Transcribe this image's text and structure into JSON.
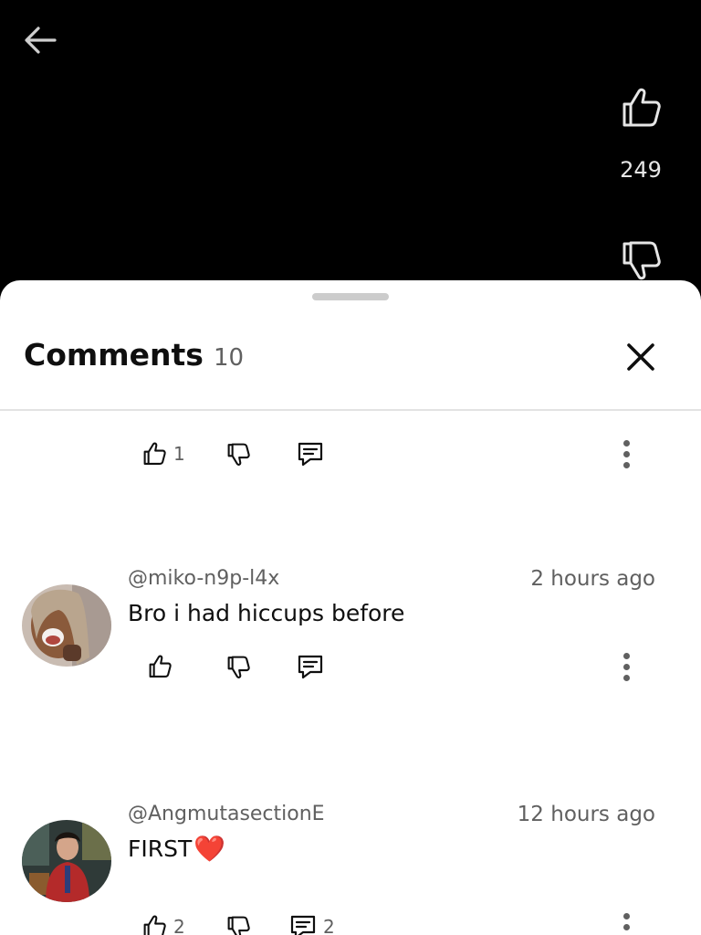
{
  "video": {
    "like_count": "249",
    "icons": {
      "back": "back-arrow-icon",
      "like": "thumbs-up-icon",
      "dislike": "thumbs-down-icon"
    }
  },
  "comments_panel": {
    "title": "Comments",
    "count": "10",
    "close_icon": "close-icon"
  },
  "comments": [
    {
      "author": "",
      "time": "",
      "text": "",
      "like_count": "1",
      "reply_count": ""
    },
    {
      "author": "@miko-n9p-l4x",
      "time": "2 hours ago",
      "text": "Bro i had hiccups before",
      "like_count": "",
      "reply_count": ""
    },
    {
      "author": "@AngmutasectionE",
      "time": "12 hours ago",
      "text": "FIRST",
      "emoji": "❤️",
      "like_count": "2",
      "reply_count": "2"
    }
  ],
  "colors": {
    "background_top": "#000000",
    "sheet": "#ffffff",
    "text_primary": "#0f0f0f",
    "text_secondary": "#606060",
    "heart": "#e3262f"
  }
}
